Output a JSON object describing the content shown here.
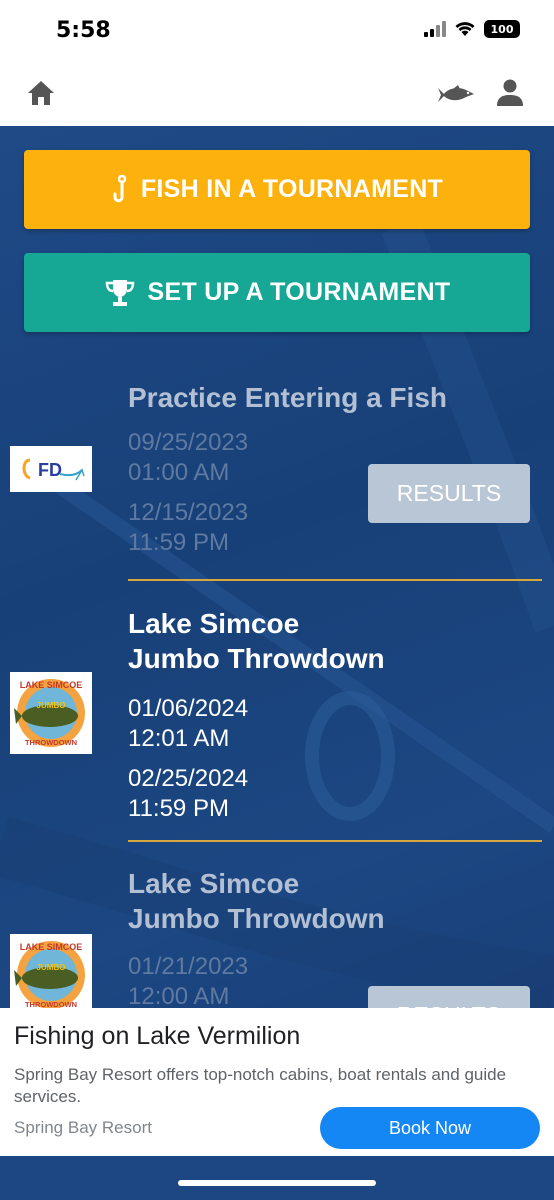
{
  "status_bar": {
    "time": "5:58",
    "battery": "100"
  },
  "nav": {
    "home_icon": "home-icon",
    "fish_icon": "fish-icon",
    "user_icon": "user-icon"
  },
  "actions": {
    "fish_label": "FISH IN A TOURNAMENT",
    "setup_label": "SET UP A TOURNAMENT",
    "fish_color": "#fdb10d",
    "setup_color": "#17a895"
  },
  "tournaments": [
    {
      "title": "Practice Entering a Fish",
      "start_date": "09/25/2023",
      "start_time": "01:00 AM",
      "end_date": "12/15/2023",
      "end_time": "11:59 PM",
      "button": "RESULTS",
      "logo_text": "FD"
    },
    {
      "title_line1": "Lake Simcoe",
      "title_line2": "Jumbo Throwdown",
      "start_date": "01/06/2024",
      "start_time": "12:01 AM",
      "end_date": "02/25/2024",
      "end_time": "11:59 PM",
      "logo_text_top": "LAKE SIMCOE",
      "logo_text_mid": "JUMBO",
      "logo_text_bottom": "THROWDOWN"
    },
    {
      "title_line1": "Lake Simcoe",
      "title_line2": "Jumbo Throwdown",
      "start_date": "01/21/2023",
      "start_time": "12:00 AM",
      "button": "RESULTS",
      "logo_text_top": "LAKE SIMCOE",
      "logo_text_mid": "JUMBO",
      "logo_text_bottom": "THROWDOWN"
    }
  ],
  "ad": {
    "title": "Fishing on Lake Vermilion",
    "description": "Spring Bay Resort offers top-notch cabins, boat rentals and guide services.",
    "source": "Spring Bay Resort",
    "cta": "Book Now"
  }
}
